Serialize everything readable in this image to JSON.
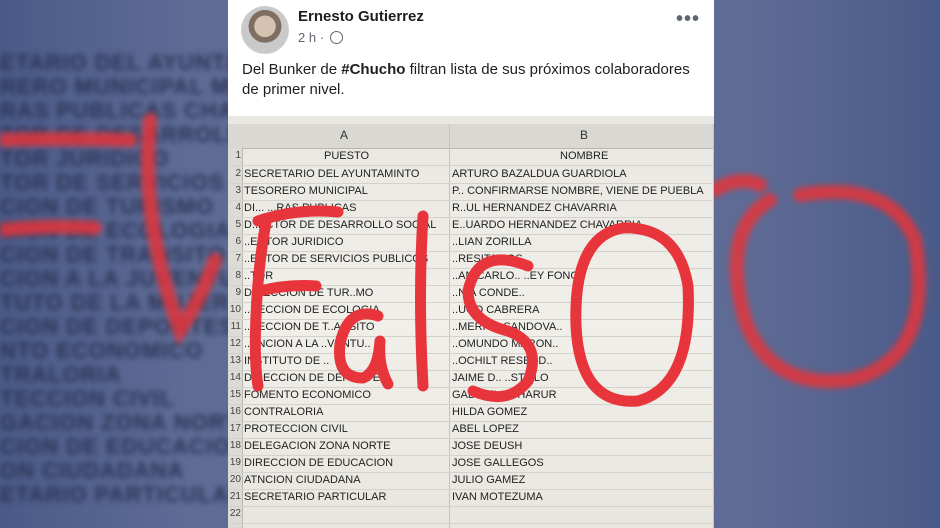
{
  "background": {
    "lines": [
      "ETARIO DEL AYUNTA          BAZALDUA GUARDIOLA",
      "RERO MUNICIPAL              MBRE, VIENE DE P",
      "RAS PUBLICAS                CHAVARRIA",
      "TOR DE DESARROLLO            CHAVARRIA",
      "TOR JURIDICO",
      "TOR DE SERVICIOS",
      "CION DE TURISMO",
      "CION DE ECOLOGIA",
      "CION DE TRANSITO",
      "CION A LA JUVENTUD",
      "TUTO DE LA MUJER",
      "CION DE DEPORTES",
      "NTO ECONOMICO",
      "TRALORIA",
      "TECCION CIVIL",
      "GACION ZONA NORTE",
      "CION DE EDUCACION",
      "ON CIUDADANA",
      "ETARIO PARTICULAR"
    ],
    "falso_text": "Falso"
  },
  "post": {
    "author": "Ernesto Gutierrez",
    "time": "2 h",
    "separator": "·",
    "more_label": "•••",
    "text_before": "Del Bunker de ",
    "hashtag": "#Chucho",
    "text_after": " filtran lista de sus próximos colaboradores de primer nivel."
  },
  "spreadsheet": {
    "column_a_letter": "A",
    "column_b_letter": "B",
    "header_a": "PUESTO",
    "header_b": "NOMBRE",
    "rows": [
      {
        "n": "2",
        "a": "SECRETARIO DEL AYUNTAMINTO",
        "b": "ARTURO BAZALDUA GUARDIOLA"
      },
      {
        "n": "3",
        "a": "TESORERO MUNICIPAL",
        "b": "P.. CONFIRMARSE NOMBRE, VIENE DE PUEBLA"
      },
      {
        "n": "4",
        "a": "DI... ...RAS PUBLICAS",
        "b": "R..UL HERNANDEZ CHAVARRIA"
      },
      {
        "n": "5",
        "a": "D..ECTOR DE DESARROLLO SOCIAL",
        "b": "E..UARDO HERNANDEZ CHAVARRIA"
      },
      {
        "n": "6",
        "a": "..ECTOR JURIDICO",
        "b": "..LIAN ZORILLA"
      },
      {
        "n": "7",
        "a": "..ECTOR DE SERVICIOS PUBLICOS",
        "b": "..RESITA SOS.."
      },
      {
        "n": "8",
        "a": "..TOR",
        "b": "..AN CARLO.. ..EY FONG"
      },
      {
        "n": "9",
        "a": "DIRECCION DE TUR..MO",
        "b": "..NIA CONDE.."
      },
      {
        "n": "10",
        "a": "..RECCION DE ECOLOGIA",
        "b": "..UGO CABRERA"
      },
      {
        "n": "11",
        "a": "..RECCION DE T..ANSITO",
        "b": "..MERICA SANDOVA.."
      },
      {
        "n": "12",
        "a": "..ENCION A LA ..VENTU..",
        "b": "..OMUNDO MARON.."
      },
      {
        "n": "13",
        "a": "INSTITUTO DE ..",
        "b": "..OCHILT RESEND.."
      },
      {
        "n": "14",
        "a": "DIRECCION DE DEPORTES",
        "b": "JAIME D.. ..STILLO"
      },
      {
        "n": "15",
        "a": "FOMENTO ECONOMICO",
        "b": "GABRIELA CHARUR"
      },
      {
        "n": "16",
        "a": "CONTRALORIA",
        "b": "HILDA GOMEZ"
      },
      {
        "n": "17",
        "a": "PROTECCION CIVIL",
        "b": "ABEL LOPEZ"
      },
      {
        "n": "18",
        "a": "DELEGACION ZONA NORTE",
        "b": "JOSE DEUSH"
      },
      {
        "n": "19",
        "a": "DIRECCION DE EDUCACION",
        "b": "JOSE GALLEGOS"
      },
      {
        "n": "20",
        "a": "ATNCION CIUDADANA",
        "b": "JULIO GAMEZ"
      },
      {
        "n": "21",
        "a": "SECRETARIO PARTICULAR",
        "b": "IVAN MOTEZUMA"
      },
      {
        "n": "22",
        "a": "",
        "b": ""
      }
    ]
  },
  "overlay": {
    "stamp_text": "Falso",
    "stamp_color": "#e8353c"
  }
}
